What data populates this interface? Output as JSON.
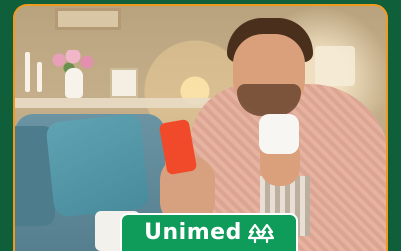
{
  "brand": {
    "name": "Unimed",
    "logo_color": "#0f9b5a",
    "frame_color": "#0f5f3a",
    "accent_border_color": "#f29a1d"
  },
  "icons": {
    "logo_mark": "unimed-trees-icon"
  }
}
